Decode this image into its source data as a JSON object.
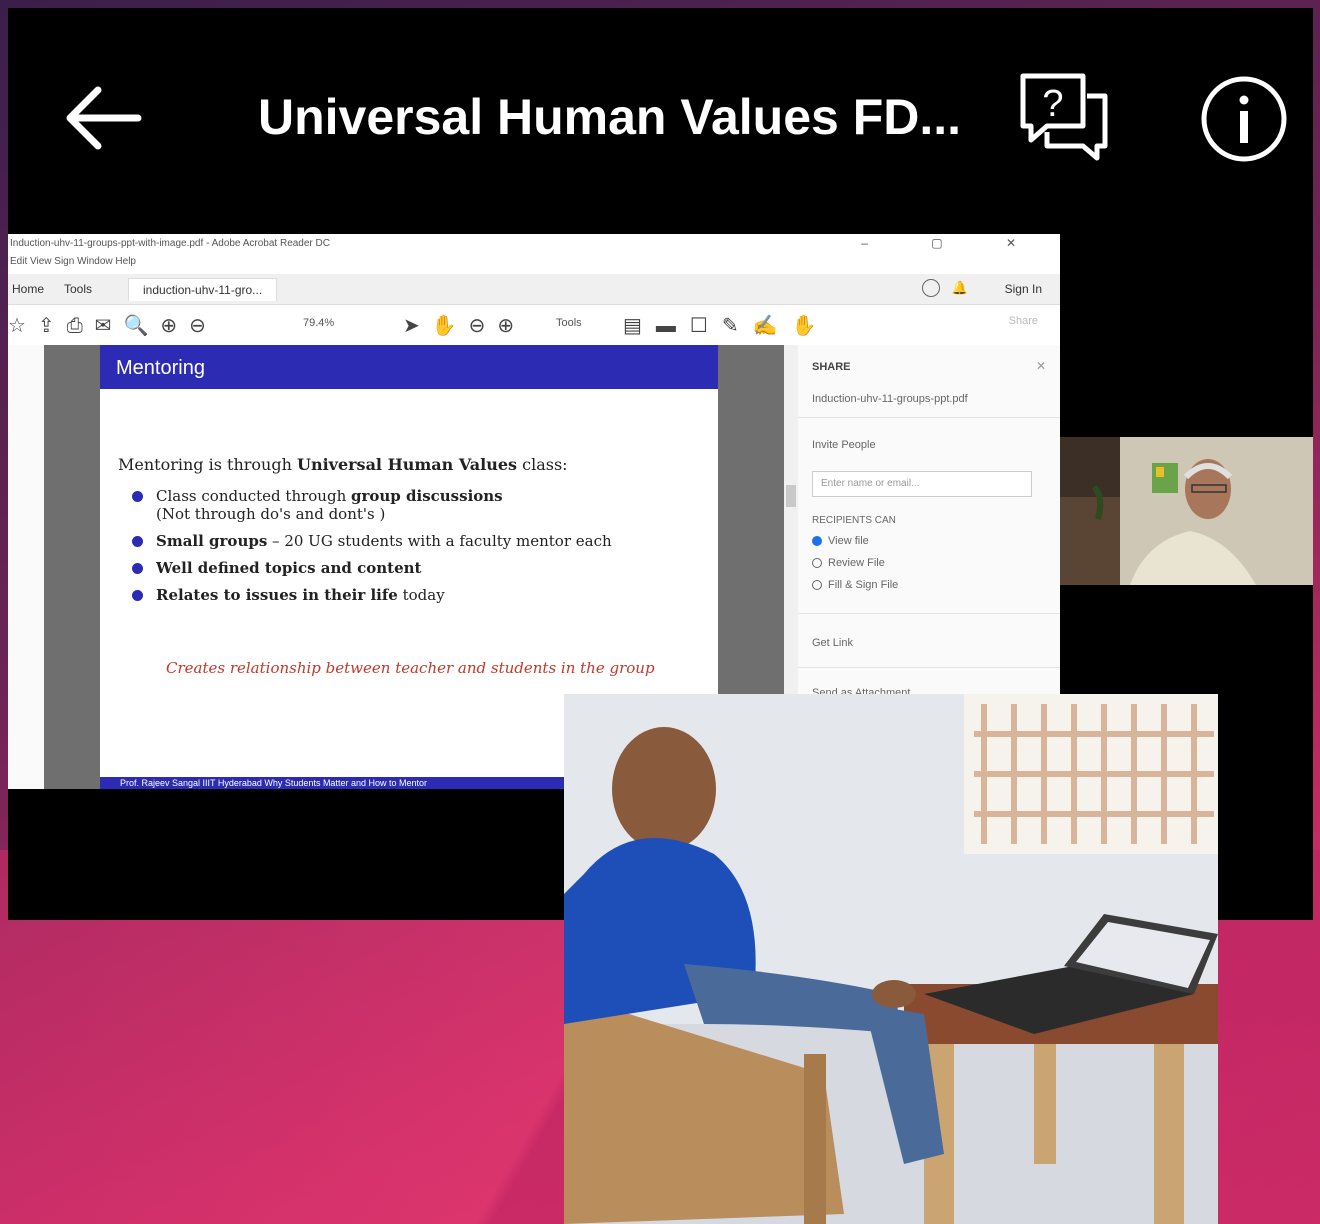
{
  "header": {
    "title": "Universal Human Values FD...",
    "back_icon": "arrow-left-icon",
    "help_icon": "question-chat-icon",
    "info_icon": "info-icon"
  },
  "reader": {
    "window_title": "Induction-uhv-11-groups-ppt-with-image.pdf - Adobe Acrobat Reader DC",
    "menu": "Edit  View  Sign  Window  Help",
    "tabs": {
      "home": "Home",
      "tools": "Tools",
      "document": "induction-uhv-11-gro..."
    },
    "sign_in": "Sign In",
    "zoom": "79.4%",
    "tools_label": "Tools",
    "share": "Share"
  },
  "slide": {
    "heading": "Mentoring",
    "intro_plain": "Mentoring is through ",
    "intro_bold": "Universal Human Values",
    "intro_end": " class:",
    "items": [
      {
        "plain": "Class conducted through ",
        "bold": "group discussions"
      },
      {
        "sub": "(Not through do's and dont's )"
      },
      {
        "bold": "Small groups",
        "plain": " – 20 UG students with a faculty mentor each"
      },
      {
        "bold": "Well defined topics and content"
      },
      {
        "bold": "Relates to issues in their life",
        "plain": " today"
      }
    ],
    "note": "Creates relationship between teacher and students in the group",
    "footer": "Prof. Rajeev Sangal IIIT Hyderabad     Why Students Matter and How to Mentor"
  },
  "side_panel": {
    "heading": "SHARE",
    "file_name": "Induction-uhv-11-groups-ppt.pdf",
    "invite": "Invite People",
    "input_placeholder": "Enter name or email...",
    "recipients": "RECIPIENTS CAN",
    "options": [
      "View file",
      "Review File",
      "Fill & Sign File"
    ],
    "get_link": "Get Link",
    "send_attachment": "Send as Attachment"
  },
  "colors": {
    "slide_blue": "#2b2bb3",
    "note_red": "#c0392b",
    "accent": "#1a73e8"
  }
}
